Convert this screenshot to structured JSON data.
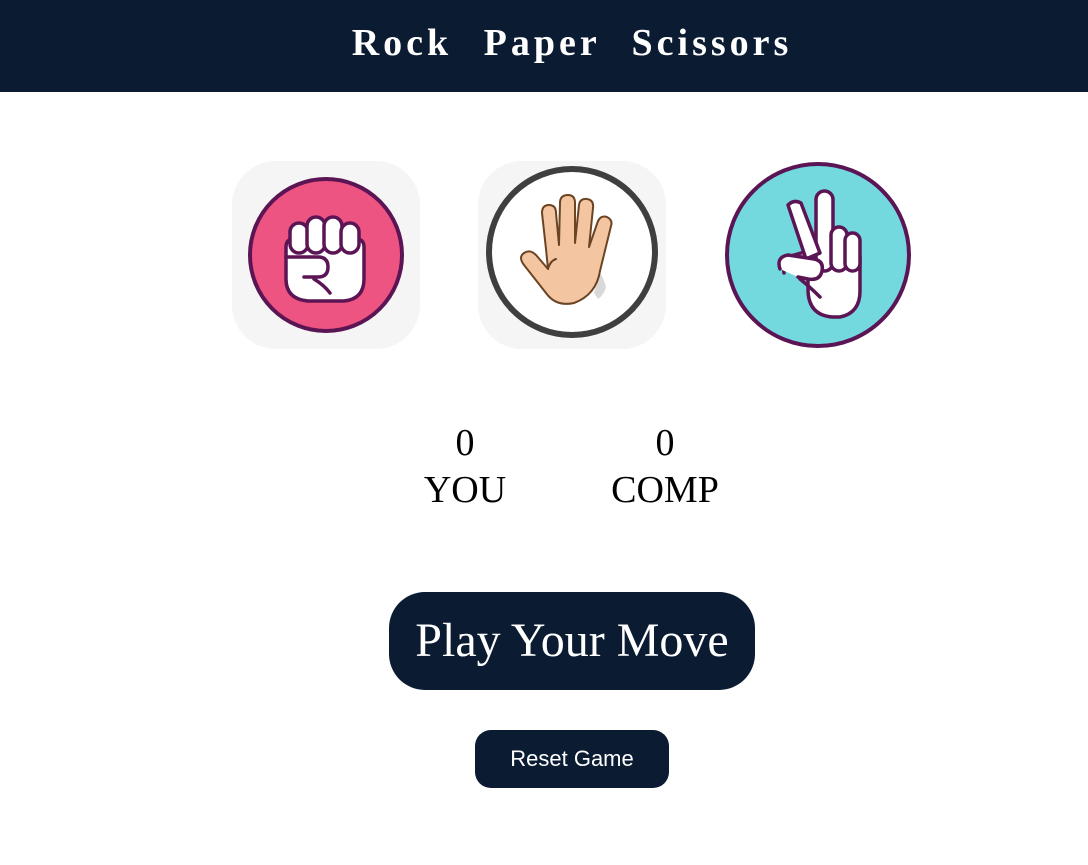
{
  "header": {
    "title": "Rock Paper Scissors"
  },
  "choices": [
    {
      "id": "rock",
      "icon": "rock-fist-icon",
      "colors": {
        "circle": "#ee5482",
        "ring": "#5c1554",
        "hand": "#ffffff"
      }
    },
    {
      "id": "paper",
      "icon": "paper-hand-icon",
      "colors": {
        "circle": "#ffffff",
        "ring": "#3f3f3f",
        "hand": "#f4c5a1"
      }
    },
    {
      "id": "scissors",
      "icon": "scissors-hand-icon",
      "colors": {
        "circle": "#74d9df",
        "ring": "#5c1554",
        "hand": "#ffffff"
      }
    }
  ],
  "scores": {
    "user": {
      "value": "0",
      "label": "YOU"
    },
    "comp": {
      "value": "0",
      "label": "COMP"
    }
  },
  "buttons": {
    "play": "Play Your Move",
    "reset": "Reset Game"
  },
  "colors": {
    "primary": "#0a1b32",
    "tile": "#f5f5f5"
  }
}
